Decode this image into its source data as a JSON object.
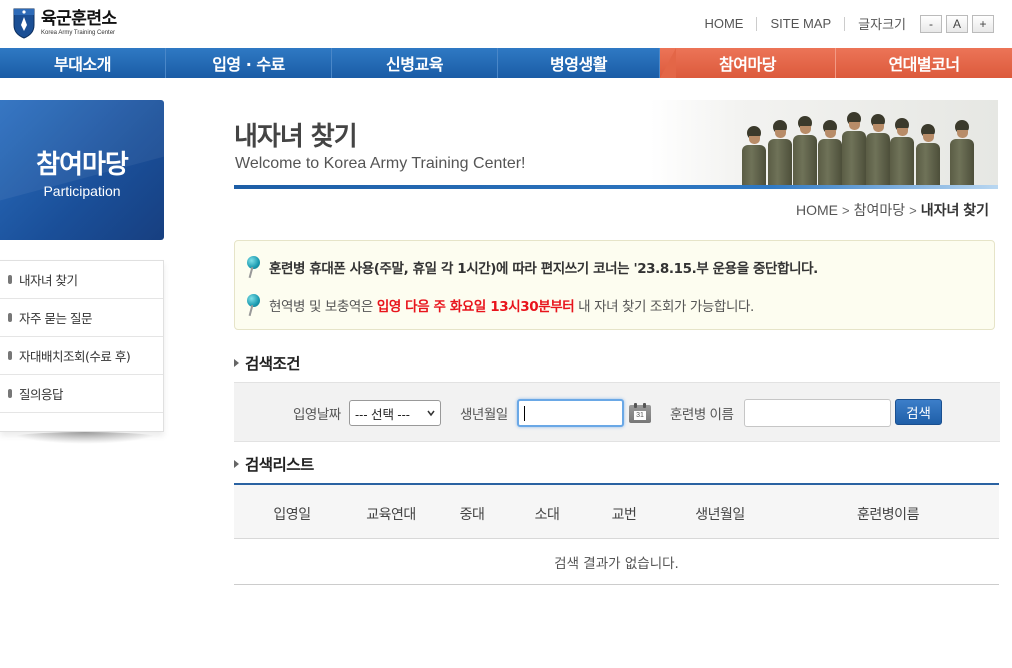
{
  "header": {
    "logo_title": "육군훈련소",
    "logo_sub": "Korea Army Training Center",
    "util": {
      "home": "HOME",
      "sitemap": "SITE MAP",
      "font_size": "글자크기",
      "minus": "-",
      "normal": "A",
      "plus": "+"
    }
  },
  "gnb": [
    "부대소개",
    "입영 · 수료",
    "신병교육",
    "병영생활",
    "참여마당",
    "연대별코너"
  ],
  "sidebar": {
    "title": "참여마당",
    "subtitle": "Participation",
    "items": [
      "내자녀 찾기",
      "자주 묻는 질문",
      "자대배치조회(수료 후)",
      "질의응답"
    ]
  },
  "page": {
    "title": "내자녀 찾기",
    "subtitle": "Welcome to Korea Army Training Center!"
  },
  "breadcrumb": [
    "HOME",
    "참여마당",
    "내자녀 찾기"
  ],
  "notice": {
    "line1": "훈련병 휴대폰 사용(주말, 휴일 각 1시간)에 따라 편지쓰기 코너는 '23.8.15.부 운용을 중단합니다.",
    "line2_pre": "현역병 및 보충역은 ",
    "line2_highlight": "입영 다음 주 화요일 13시30분부터",
    "line2_post": " 내 자녀 찾기 조회가 가능합니다."
  },
  "search": {
    "section_title": "검색조건",
    "date_label": "입영날짜",
    "date_select": "--- 선택 ---",
    "birth_label": "생년월일",
    "birth_value": "",
    "calendar_number": "31",
    "name_label": "훈련병 이름",
    "name_value": "",
    "button": "검색"
  },
  "results": {
    "section_title": "검색리스트",
    "columns": [
      "입영일",
      "교육연대",
      "중대",
      "소대",
      "교번",
      "생년월일",
      "훈련병이름"
    ],
    "empty_message": "검색 결과가 없습니다."
  },
  "colors": {
    "primary_blue": "#1d63ad",
    "accent_red": "#e36647",
    "highlight_red": "#e8141c"
  }
}
